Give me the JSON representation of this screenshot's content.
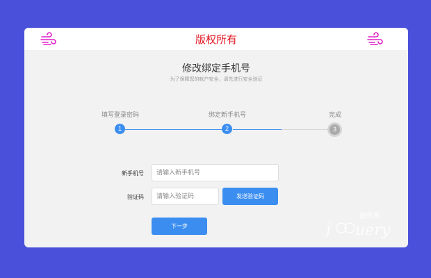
{
  "header": {
    "title": "版权所有",
    "logo_left_icon": "wind-lines-icon",
    "logo_right_icon": "wind-lines-icon",
    "logo_color": "#e020c8",
    "title_color": "#e0141e"
  },
  "page": {
    "heading": "修改绑定手机号",
    "subheading": "为了保障您的帐户安全，请先进行安全验证"
  },
  "steps": [
    {
      "label": "填写登录密码",
      "number": "1",
      "state": "done"
    },
    {
      "label": "绑定新手机号",
      "number": "2",
      "state": "current"
    },
    {
      "label": "完成",
      "number": "3",
      "state": "pending"
    }
  ],
  "form": {
    "phone": {
      "label": "新手机号",
      "value": "",
      "placeholder": "请输入新手机号"
    },
    "code": {
      "label": "验证码",
      "value": "",
      "placeholder": "请输入验证码"
    },
    "send_code_label": "发送验证码",
    "next_label": "下一步"
  },
  "watermark": {
    "brand": "jQuery",
    "sub": "插件库"
  },
  "colors": {
    "background": "#4a50d9",
    "card": "#f2f2f2",
    "accent": "#3b8ef0",
    "pending": "#a9a9a9"
  }
}
